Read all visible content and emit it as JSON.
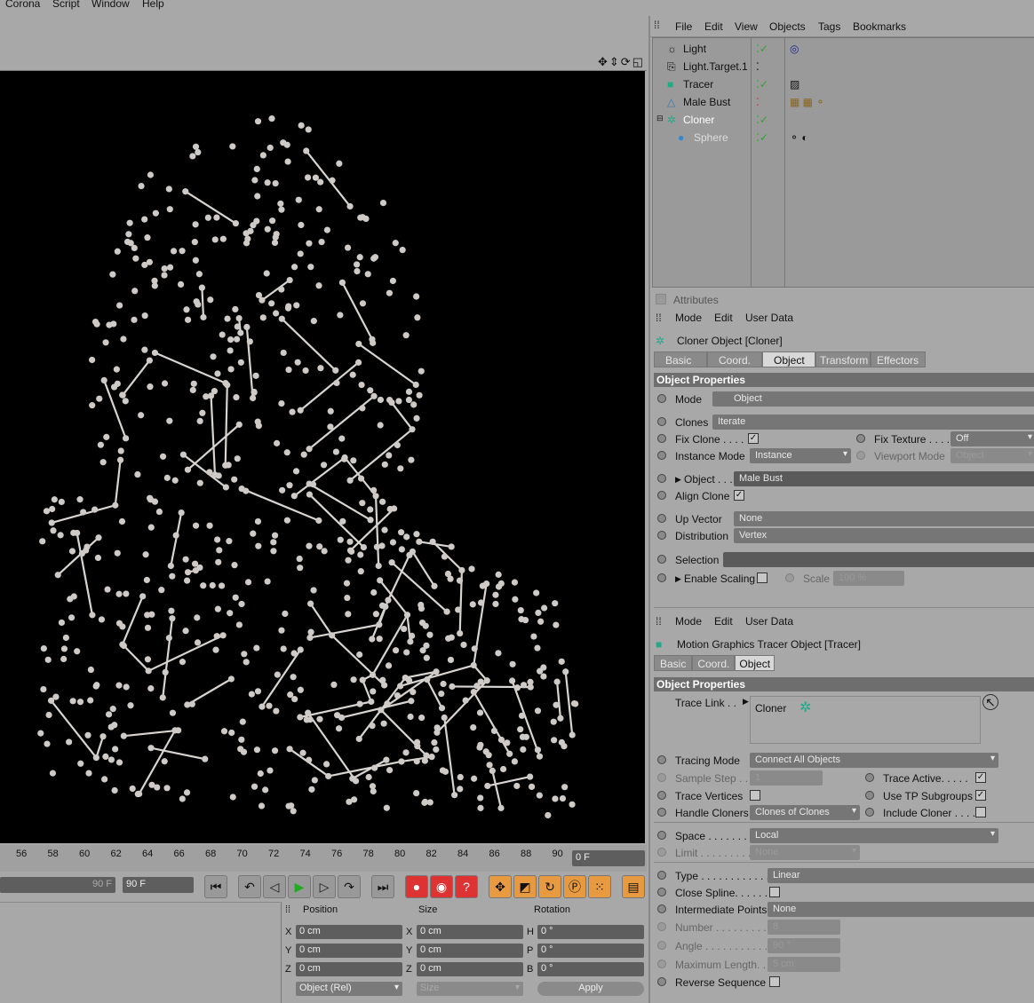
{
  "menubar": {
    "corona": "Corona",
    "script": "Script",
    "window": "Window",
    "help": "Help"
  },
  "viewport": {
    "icons": [
      "move-icon",
      "zoom-icon",
      "rotate-icon",
      "maximize-icon"
    ]
  },
  "timeline": {
    "ticks": [
      "56",
      "58",
      "60",
      "62",
      "64",
      "66",
      "68",
      "70",
      "72",
      "74",
      "76",
      "78",
      "80",
      "82",
      "84",
      "86",
      "88",
      "90"
    ],
    "current": "0 F",
    "end_small": "90 F",
    "end": "90 F"
  },
  "coords": {
    "position": "Position",
    "size": "Size",
    "rotation": "Rotation",
    "x": "X",
    "y": "Y",
    "z": "Z",
    "h": "H",
    "p": "P",
    "b": "B",
    "zero_cm": "0 cm",
    "zero_deg": "0 °",
    "mode": "Object (Rel)",
    "size_mode": "Size",
    "apply": "Apply"
  },
  "om": {
    "file": "File",
    "edit": "Edit",
    "view": "View",
    "objects": "Objects",
    "tags": "Tags",
    "bookmarks": "Bookmarks",
    "items": [
      "Light",
      "Light.Target.1",
      "Tracer",
      "Male Bust",
      "Cloner",
      "Sphere"
    ]
  },
  "attrs": {
    "title": "Attributes",
    "mode": "Mode",
    "edit": "Edit",
    "userdata": "User Data",
    "cloner_title": "Cloner Object [Cloner]",
    "tabs1": [
      "Basic",
      "Coord.",
      "Object",
      "Transform",
      "Effectors"
    ],
    "objprops": "Object Properties",
    "mode_lbl": "Mode",
    "mode_val": "Object",
    "clones_lbl": "Clones",
    "clones_val": "Iterate",
    "fixclone": "Fix Clone . . . .",
    "fixtex": "Fix Texture . . . .",
    "fixtex_val": "Off",
    "instmode": "Instance Mode",
    "instmode_val": "Instance",
    "vpmode": "Viewport Mode",
    "vpmode_val": "Object",
    "object_lbl": "Object . . .",
    "object_val": "Male Bust",
    "align": "Align Clone",
    "upvec": "Up Vector",
    "upvec_val": "None",
    "dist": "Distribution",
    "dist_val": "Vertex",
    "sel": "Selection",
    "enscale": "Enable Scaling",
    "scale": "Scale",
    "scale_val": "100 %",
    "tracer_title": "Motion Graphics Tracer Object [Tracer]",
    "tabs2": [
      "Basic",
      "Coord.",
      "Object"
    ],
    "tracelink": "Trace Link . .",
    "tracelink_val": "Cloner",
    "tmode": "Tracing Mode",
    "tmode_val": "Connect All Objects",
    "sstep": "Sample Step . .",
    "sstep_val": "1",
    "tactive": "Trace Active. . . . .",
    "tverts": "Trace Vertices",
    "usetp": "Use TP Subgroups",
    "hcloners": "Handle Cloners",
    "hcloners_val": "Clones of Clones",
    "inclcloner": "Include Cloner . . . .",
    "space": "Space . . . . . . . .",
    "space_val": "Local",
    "limit": "Limit . . . . . . . . .",
    "limit_val": "None",
    "type": "Type . . . . . . . . . . . .",
    "type_val": "Linear",
    "closespline": "Close Spline. . . . . .",
    "interp": "Intermediate Points",
    "interp_val": "None",
    "number": "Number . . . . . . . . .",
    "number_val": "8",
    "angle": "Angle . . . . . . . . . . .",
    "angle_val": "90 °",
    "maxlen": "Maximum Length. . .",
    "maxlen_val": "5 cm",
    "revseq": "Reverse Sequence"
  }
}
